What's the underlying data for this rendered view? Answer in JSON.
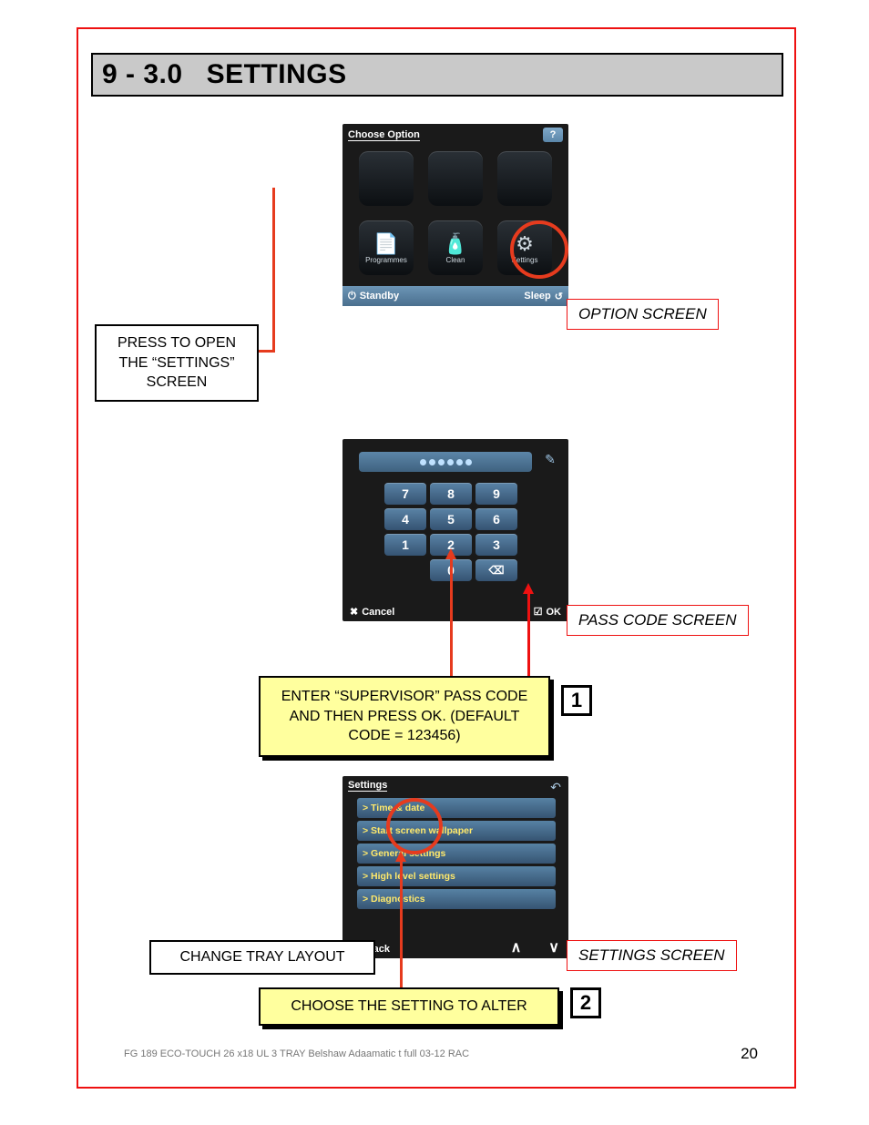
{
  "title": {
    "section": "9 - 3.0",
    "heading": "SETTINGS"
  },
  "screen1": {
    "header": "Choose Option",
    "help": "?",
    "icons": {
      "programmes": "Programmes",
      "clean": "Clean",
      "settings": "Settings"
    },
    "standby": "Standby",
    "sleep": "Sleep"
  },
  "callouts": {
    "press_open": "PRESS TO OPEN THE “SETTINGS” SCREEN",
    "option_label": "OPTION SCREEN",
    "passcode_label": "PASS CODE SCREEN",
    "enter_code": "ENTER “SUPERVISOR” PASS CODE AND THEN PRESS OK. (DEFAULT CODE = 123456)",
    "change_tray": "CHANGE TRAY LAYOUT",
    "settings_label": "SETTINGS SCREEN",
    "choose_setting": "CHOOSE THE SETTING TO ALTER",
    "num1": "1",
    "num2": "2"
  },
  "screen2": {
    "dots": 6,
    "keys": [
      "7",
      "8",
      "9",
      "4",
      "5",
      "6",
      "1",
      "2",
      "3",
      "",
      "0",
      "⌫"
    ],
    "cancel": "Cancel",
    "ok": "OK",
    "edit_icon": "✎"
  },
  "screen3": {
    "header": "Settings",
    "return_icon": "↶",
    "items": [
      "> Time & date",
      "> Start screen wallpaper",
      "> General settings",
      "> High level settings",
      "> Diagnostics"
    ],
    "back": "Back",
    "up": "∧",
    "down": "∨"
  },
  "footer": {
    "line": "FG 189 ECO-TOUCH 26 x18 UL 3 TRAY Belshaw Adaamatic t full 03-12 RAC",
    "page": "20"
  }
}
